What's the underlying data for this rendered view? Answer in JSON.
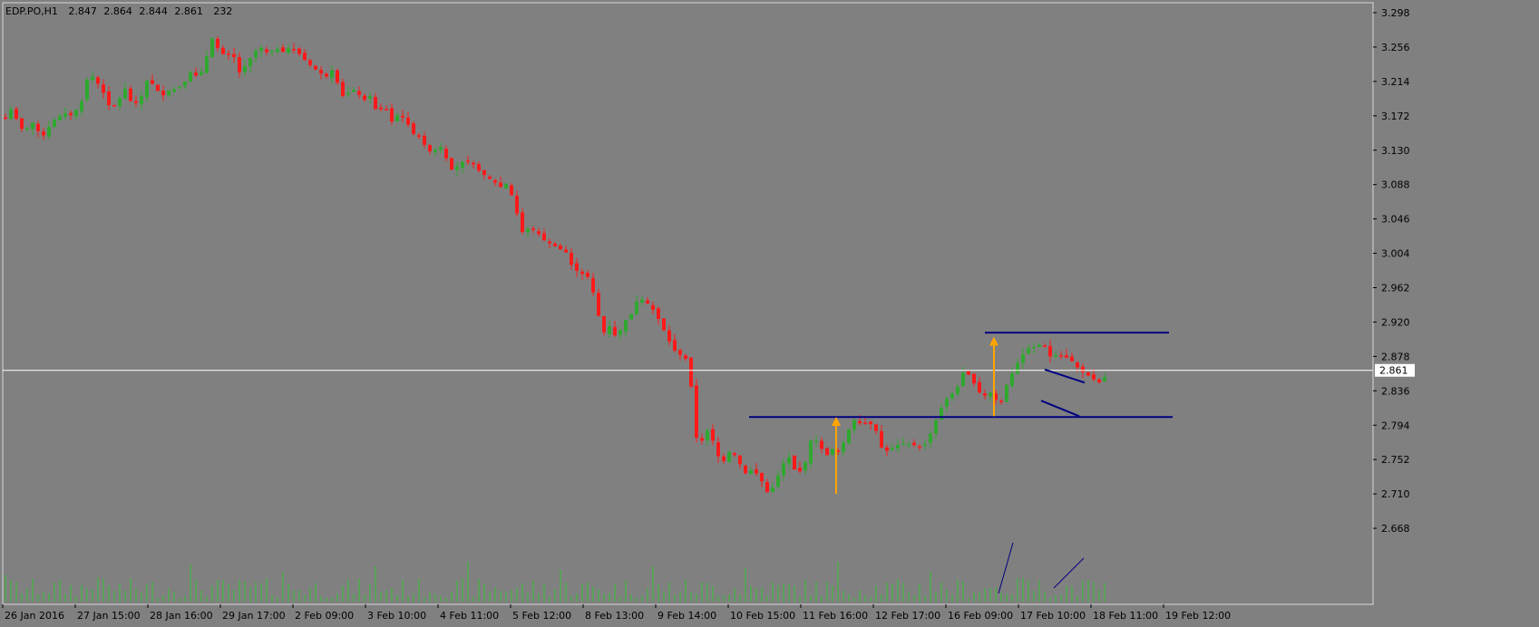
{
  "header": {
    "symbol": "EDP.PO,H1",
    "open": "2.847",
    "high": "2.864",
    "low": "2.844",
    "close": "2.861",
    "volume": "232"
  },
  "colors": {
    "background": "#808080",
    "bull": "#2fa82f",
    "bear": "#ff1a1a",
    "volume": "#35c435",
    "trendline": "#000080",
    "arrow": "#ffa500",
    "price_line": "#ffffff"
  },
  "chart_data": {
    "type": "candlestick",
    "ylim": [
      2.626,
      3.298
    ],
    "y_ticks": [
      "3.298",
      "3.256",
      "3.214",
      "3.172",
      "3.130",
      "3.088",
      "3.046",
      "3.004",
      "2.962",
      "2.920",
      "2.878",
      "2.836",
      "2.794",
      "2.752",
      "2.710",
      "2.668"
    ],
    "x_ticks": [
      "26 Jan 2016",
      "27 Jan 15:00",
      "28 Jan 16:00",
      "29 Jan 17:00",
      "2 Feb 09:00",
      "3 Feb 10:00",
      "4 Feb 11:00",
      "5 Feb 12:00",
      "8 Feb 13:00",
      "9 Feb 14:00",
      "10 Feb 15:00",
      "11 Feb 16:00",
      "12 Feb 17:00",
      "16 Feb 09:00",
      "17 Feb 10:00",
      "18 Feb 11:00",
      "19 Feb 12:00"
    ],
    "current_price": "2.861",
    "horizontal_levels": [
      2.804,
      2.907
    ],
    "close_path": [
      [
        0,
        3.163
      ],
      [
        8,
        3.17
      ],
      [
        14,
        3.185
      ],
      [
        20,
        3.16
      ],
      [
        28,
        3.152
      ],
      [
        34,
        3.168
      ],
      [
        40,
        3.155
      ],
      [
        48,
        3.148
      ],
      [
        55,
        3.16
      ],
      [
        62,
        3.17
      ],
      [
        72,
        3.175
      ],
      [
        80,
        3.172
      ],
      [
        90,
        3.19
      ],
      [
        98,
        3.225
      ],
      [
        106,
        3.215
      ],
      [
        114,
        3.2
      ],
      [
        122,
        3.18
      ],
      [
        130,
        3.19
      ],
      [
        138,
        3.205
      ],
      [
        146,
        3.185
      ],
      [
        154,
        3.19
      ],
      [
        162,
        3.215
      ],
      [
        170,
        3.21
      ],
      [
        178,
        3.195
      ],
      [
        186,
        3.203
      ],
      [
        194,
        3.205
      ],
      [
        202,
        3.21
      ],
      [
        210,
        3.225
      ],
      [
        218,
        3.22
      ],
      [
        226,
        3.232
      ],
      [
        232,
        3.27
      ],
      [
        240,
        3.255
      ],
      [
        248,
        3.245
      ],
      [
        256,
        3.25
      ],
      [
        264,
        3.225
      ],
      [
        272,
        3.235
      ],
      [
        280,
        3.25
      ],
      [
        288,
        3.255
      ],
      [
        296,
        3.248
      ],
      [
        304,
        3.255
      ],
      [
        312,
        3.25
      ],
      [
        320,
        3.256
      ],
      [
        328,
        3.25
      ],
      [
        336,
        3.24
      ],
      [
        344,
        3.232
      ],
      [
        352,
        3.225
      ],
      [
        360,
        3.22
      ],
      [
        368,
        3.23
      ],
      [
        376,
        3.195
      ],
      [
        384,
        3.2
      ],
      [
        392,
        3.205
      ],
      [
        400,
        3.19
      ],
      [
        408,
        3.196
      ],
      [
        416,
        3.175
      ],
      [
        424,
        3.185
      ],
      [
        432,
        3.165
      ],
      [
        440,
        3.175
      ],
      [
        448,
        3.165
      ],
      [
        456,
        3.15
      ],
      [
        464,
        3.145
      ],
      [
        472,
        3.128
      ],
      [
        480,
        3.13
      ],
      [
        488,
        3.135
      ],
      [
        496,
        3.105
      ],
      [
        504,
        3.11
      ],
      [
        512,
        3.118
      ],
      [
        520,
        3.115
      ],
      [
        528,
        3.105
      ],
      [
        536,
        3.098
      ],
      [
        544,
        3.092
      ],
      [
        552,
        3.085
      ],
      [
        560,
        3.09
      ],
      [
        568,
        3.06
      ],
      [
        576,
        3.03
      ],
      [
        584,
        3.035
      ],
      [
        592,
        3.03
      ],
      [
        600,
        3.02
      ],
      [
        608,
        3.015
      ],
      [
        616,
        3.01
      ],
      [
        624,
        3.005
      ],
      [
        632,
        2.985
      ],
      [
        640,
        2.98
      ],
      [
        648,
        2.975
      ],
      [
        656,
        2.95
      ],
      [
        664,
        2.905
      ],
      [
        672,
        2.915
      ],
      [
        680,
        2.9
      ],
      [
        688,
        2.92
      ],
      [
        696,
        2.93
      ],
      [
        704,
        2.95
      ],
      [
        712,
        2.945
      ],
      [
        720,
        2.935
      ],
      [
        728,
        2.92
      ],
      [
        736,
        2.9
      ],
      [
        744,
        2.885
      ],
      [
        752,
        2.878
      ],
      [
        760,
        2.872
      ],
      [
        766,
        2.78
      ],
      [
        774,
        2.775
      ],
      [
        782,
        2.792
      ],
      [
        790,
        2.758
      ],
      [
        798,
        2.75
      ],
      [
        806,
        2.765
      ],
      [
        814,
        2.75
      ],
      [
        822,
        2.735
      ],
      [
        830,
        2.74
      ],
      [
        838,
        2.73
      ],
      [
        846,
        2.712
      ],
      [
        854,
        2.72
      ],
      [
        862,
        2.745
      ],
      [
        870,
        2.755
      ],
      [
        878,
        2.735
      ],
      [
        886,
        2.74
      ],
      [
        894,
        2.775
      ],
      [
        902,
        2.775
      ],
      [
        910,
        2.755
      ],
      [
        918,
        2.765
      ],
      [
        926,
        2.76
      ],
      [
        934,
        2.785
      ],
      [
        942,
        2.8
      ],
      [
        950,
        2.795
      ],
      [
        958,
        2.798
      ],
      [
        966,
        2.787
      ],
      [
        974,
        2.76
      ],
      [
        982,
        2.765
      ],
      [
        990,
        2.77
      ],
      [
        998,
        2.772
      ],
      [
        1006,
        2.77
      ],
      [
        1014,
        2.768
      ],
      [
        1022,
        2.772
      ],
      [
        1030,
        2.795
      ],
      [
        1038,
        2.815
      ],
      [
        1046,
        2.83
      ],
      [
        1054,
        2.835
      ],
      [
        1062,
        2.858
      ],
      [
        1070,
        2.855
      ],
      [
        1078,
        2.835
      ],
      [
        1086,
        2.83
      ],
      [
        1094,
        2.835
      ],
      [
        1102,
        2.815
      ],
      [
        1110,
        2.843
      ],
      [
        1118,
        2.862
      ],
      [
        1126,
        2.878
      ],
      [
        1134,
        2.888
      ],
      [
        1142,
        2.89
      ],
      [
        1150,
        2.895
      ],
      [
        1158,
        2.878
      ],
      [
        1166,
        2.88
      ],
      [
        1174,
        2.878
      ],
      [
        1182,
        2.872
      ],
      [
        1190,
        2.862
      ],
      [
        1198,
        2.856
      ],
      [
        1206,
        2.85
      ],
      [
        1214,
        2.845
      ],
      [
        1222,
        2.861
      ]
    ]
  }
}
